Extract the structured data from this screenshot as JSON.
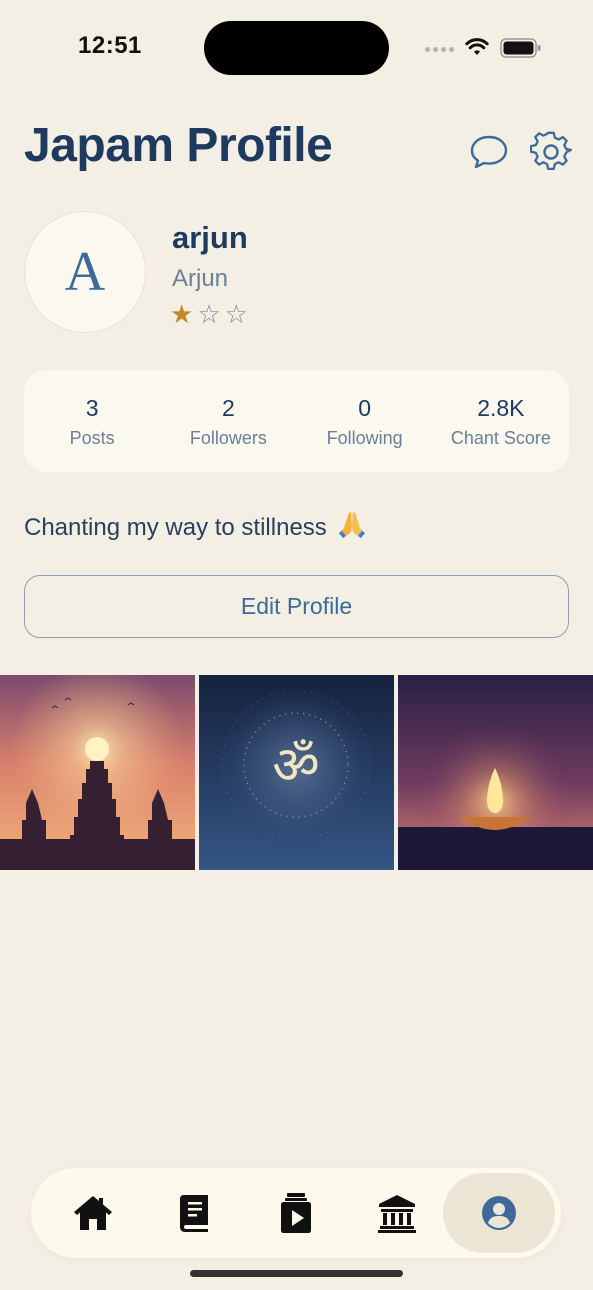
{
  "status_bar": {
    "time": "12:51"
  },
  "header": {
    "title": "Japam Profile",
    "chat_icon": "chat-bubble-icon",
    "settings_icon": "gear-icon"
  },
  "profile": {
    "avatar_letter": "A",
    "username": "arjun",
    "display_name": "Arjun",
    "rating": {
      "filled": 1,
      "total": 3
    },
    "bio": "Chanting my way to stillness",
    "bio_emoji": "🙏"
  },
  "stats": [
    {
      "value": "3",
      "label": "Posts"
    },
    {
      "value": "2",
      "label": "Followers"
    },
    {
      "value": "0",
      "label": "Following"
    },
    {
      "value": "2.8K",
      "label": "Chant Score"
    }
  ],
  "actions": {
    "edit_profile": "Edit Profile"
  },
  "posts": [
    {
      "name": "post-temple-sunset",
      "scene": "temple silhouette at sunset"
    },
    {
      "name": "post-om-symbol",
      "scene": "om symbol on blue"
    },
    {
      "name": "post-diya-lamp",
      "scene": "oil lamp at dusk"
    }
  ],
  "tab_bar": {
    "tabs": [
      {
        "icon": "home-icon"
      },
      {
        "icon": "book-icon"
      },
      {
        "icon": "japa-video-icon"
      },
      {
        "icon": "temple-icon"
      },
      {
        "icon": "profile-icon",
        "active": true
      }
    ]
  },
  "colors": {
    "background": "#f4efe4",
    "primary": "#1f3a5f",
    "accent": "#3d6a98",
    "star": "#c0892d"
  }
}
